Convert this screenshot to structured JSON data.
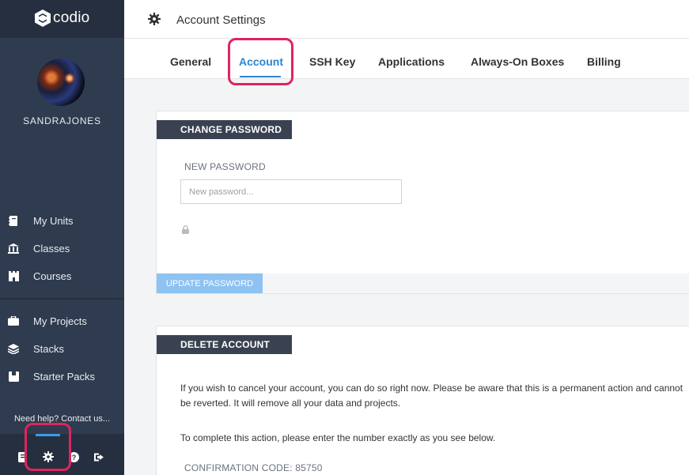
{
  "app": {
    "logo_text": "codio"
  },
  "user": {
    "username": "SANDRAJONES"
  },
  "sidebar": {
    "primary": [
      {
        "label": "My Units",
        "icon": "notebook-icon"
      },
      {
        "label": "Classes",
        "icon": "institution-icon"
      },
      {
        "label": "Courses",
        "icon": "castle-icon"
      }
    ],
    "secondary": [
      {
        "label": "My Projects",
        "icon": "briefcase-icon"
      },
      {
        "label": "Stacks",
        "icon": "layers-icon"
      },
      {
        "label": "Starter Packs",
        "icon": "package-icon"
      }
    ],
    "help_text": "Need help? Contact us...",
    "bottom_icons": [
      "book-icon",
      "gear-icon",
      "help-circle-icon",
      "logout-icon"
    ]
  },
  "header": {
    "title": "Account Settings",
    "icon": "gear-icon"
  },
  "tabs": [
    {
      "label": "General",
      "active": false
    },
    {
      "label": "Account",
      "active": true
    },
    {
      "label": "SSH Key",
      "active": false
    },
    {
      "label": "Applications",
      "active": false
    },
    {
      "label": "Always-On Boxes",
      "active": false
    },
    {
      "label": "Billing",
      "active": false
    }
  ],
  "change_password": {
    "title": "CHANGE PASSWORD",
    "field_label": "NEW PASSWORD",
    "placeholder": "New password...",
    "value": "",
    "button_label": "UPDATE PASSWORD"
  },
  "delete_account": {
    "title": "DELETE ACCOUNT",
    "paragraph1": "If you wish to cancel your account, you can do so right now. Please be aware that this is a permanent action and cannot be reverted. It will remove all your data and projects.",
    "paragraph2": "To complete this action, please enter the number exactly as you see below.",
    "confirmation_label": "CONFIRMATION CODE: 85750"
  },
  "colors": {
    "sidebar_bg": "#2f3b4e",
    "sidebar_dark": "#252f3f",
    "accent": "#2c85d4",
    "highlight": "#e0245e",
    "button_disabled": "#8ec2f3",
    "panel_header": "#3a4252"
  }
}
